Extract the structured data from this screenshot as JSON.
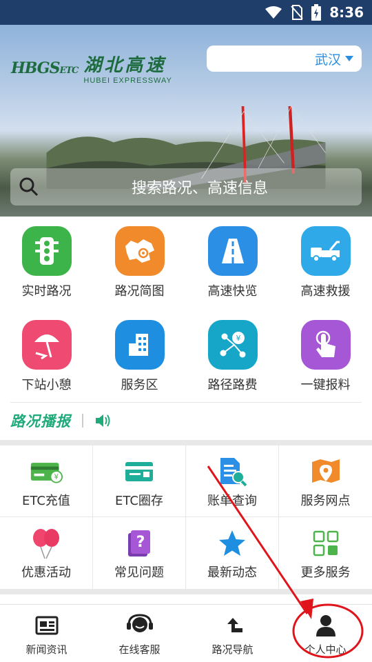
{
  "status_bar": {
    "time": "8:36"
  },
  "header": {
    "logo_mark": "HBGS",
    "logo_mark_suffix": "ETC",
    "logo_cn": "湖北高速",
    "logo_en": "HUBEI EXPRESSWAY",
    "city": "武汉",
    "search_placeholder": "搜索路况、高速信息"
  },
  "quick_grid": [
    {
      "label": "实时路况",
      "icon": "traffic-light-icon",
      "color": "#3cb44a"
    },
    {
      "label": "路况简图",
      "icon": "province-map-icon",
      "color": "#f08a2b"
    },
    {
      "label": "高速快览",
      "icon": "road-icon",
      "color": "#2b8fe6"
    },
    {
      "label": "高速救援",
      "icon": "tow-truck-icon",
      "color": "#2fa9e8"
    },
    {
      "label": "下站小憩",
      "icon": "beach-umbrella-icon",
      "color": "#ef4a72"
    },
    {
      "label": "服务区",
      "icon": "building-icon",
      "color": "#1e8fe0"
    },
    {
      "label": "路径路费",
      "icon": "route-fee-icon",
      "color": "#16a6c8"
    },
    {
      "label": "一键报料",
      "icon": "tap-hand-icon",
      "color": "#a657d6"
    }
  ],
  "ticker": {
    "title": "路况播报"
  },
  "services": [
    {
      "label": "ETC充值",
      "icon": "etc-card-icon"
    },
    {
      "label": "ETC圈存",
      "icon": "etc-deposit-icon"
    },
    {
      "label": "账单查询",
      "icon": "bill-search-icon"
    },
    {
      "label": "服务网点",
      "icon": "map-pin-icon"
    },
    {
      "label": "优惠活动",
      "icon": "balloons-icon"
    },
    {
      "label": "常见问题",
      "icon": "faq-icon"
    },
    {
      "label": "最新动态",
      "icon": "star-icon"
    },
    {
      "label": "更多服务",
      "icon": "grid-icon"
    }
  ],
  "bottom_nav": [
    {
      "label": "新闻资讯",
      "icon": "newspaper-icon"
    },
    {
      "label": "在线客服",
      "icon": "headset-icon"
    },
    {
      "label": "路况导航",
      "icon": "turn-arrow-icon"
    },
    {
      "label": "个人中心",
      "icon": "person-icon"
    }
  ],
  "colors": {
    "status_bar": "#1f3e6a",
    "accent": "#2a8ee0",
    "ticker_green": "#1faa7a",
    "annotation_red": "#e0151b"
  }
}
